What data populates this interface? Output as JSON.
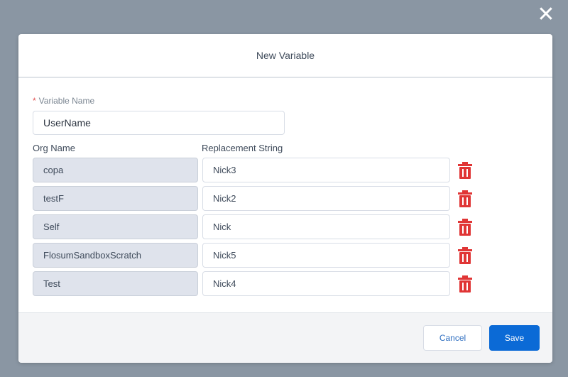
{
  "modal": {
    "title": "New Variable",
    "close_icon": "close-icon"
  },
  "form": {
    "variable_name_label": "Variable Name",
    "required_marker": "*",
    "variable_name_value": "UserName",
    "org_name_header": "Org Name",
    "replacement_header": "Replacement String"
  },
  "rows": [
    {
      "org": "copa",
      "replacement": "Nick3"
    },
    {
      "org": "testF",
      "replacement": "Nick2"
    },
    {
      "org": "Self",
      "replacement": "Nick"
    },
    {
      "org": "FlosumSandboxScratch",
      "replacement": "Nick5"
    },
    {
      "org": "Test",
      "replacement": "Nick4"
    }
  ],
  "icons": {
    "row_delete": "trash-icon"
  },
  "footer": {
    "cancel_label": "Cancel",
    "save_label": "Save"
  },
  "colors": {
    "brand_blue": "#0b6ad6",
    "delete_red": "#e03535"
  }
}
